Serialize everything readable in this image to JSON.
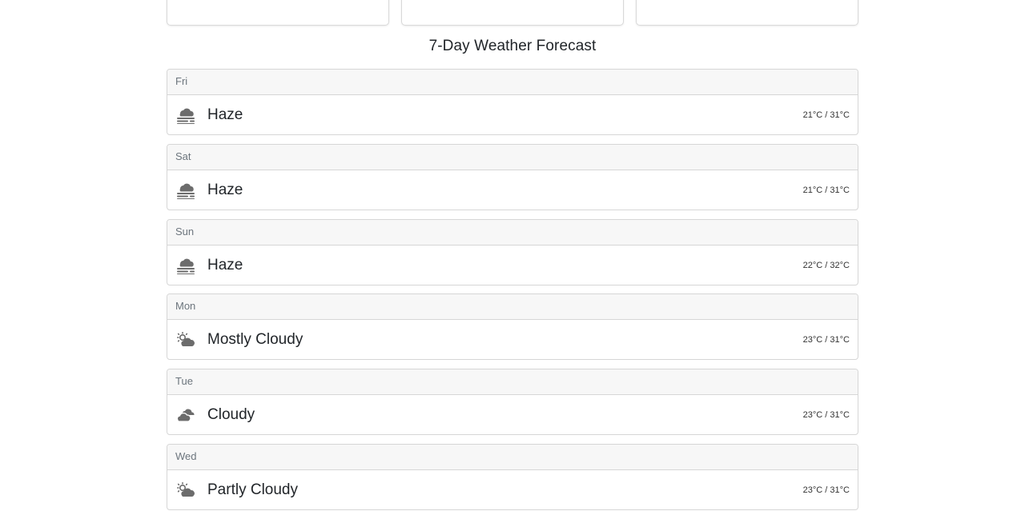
{
  "forecast": {
    "title": "7-Day Weather Forecast",
    "days": [
      {
        "day": "Fri",
        "condition": "Haze",
        "temps": "21°C / 31°C",
        "icon": "haze-icon"
      },
      {
        "day": "Sat",
        "condition": "Haze",
        "temps": "21°C / 31°C",
        "icon": "haze-icon"
      },
      {
        "day": "Sun",
        "condition": "Haze",
        "temps": "22°C / 32°C",
        "icon": "haze-icon"
      },
      {
        "day": "Mon",
        "condition": "Mostly Cloudy",
        "temps": "23°C / 31°C",
        "icon": "mostly-cloudy-icon"
      },
      {
        "day": "Tue",
        "condition": "Cloudy",
        "temps": "23°C / 31°C",
        "icon": "cloudy-icon"
      },
      {
        "day": "Wed",
        "condition": "Partly Cloudy",
        "temps": "23°C / 31°C",
        "icon": "partly-cloudy-icon"
      }
    ]
  },
  "colors": {
    "icon": "#6c6c6c",
    "header_bg": "#f7f7f7",
    "border": "#d6d6d6"
  }
}
